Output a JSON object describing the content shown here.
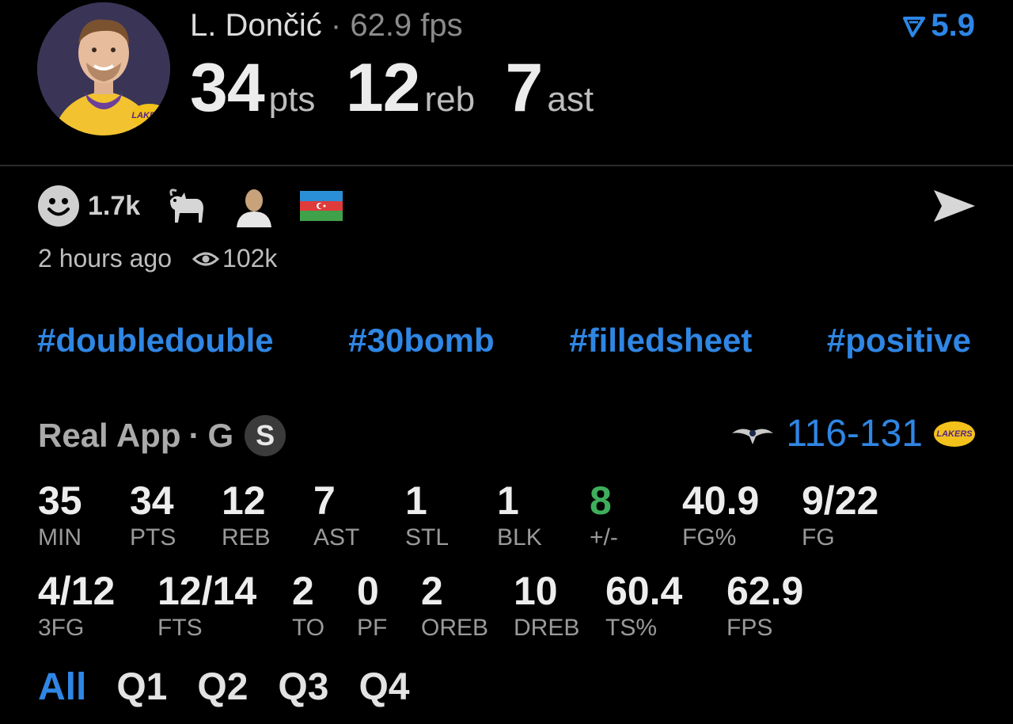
{
  "player": {
    "name": "L. Dončić",
    "separator": "·",
    "fps_text": "62.9 fps",
    "pts": "34",
    "pts_unit": "pts",
    "reb": "12",
    "reb_unit": "reb",
    "ast": "7",
    "ast_unit": "ast",
    "team_logo_text": "LAKERS"
  },
  "trend": {
    "value": "5.9",
    "icon": "trend-arrow-icon",
    "color": "#2d86e6"
  },
  "reactions": {
    "count": "1.7k",
    "icons": [
      "smiley-icon",
      "goat-icon",
      "person-emoji-icon",
      "azerbaijan-flag-icon"
    ]
  },
  "meta": {
    "time": "2 hours ago",
    "views": "102k"
  },
  "tags": [
    "#doubledouble",
    "#30bomb",
    "#filledsheet",
    "#positive"
  ],
  "game": {
    "source": "Real App",
    "separator": "·",
    "position": "G",
    "badge": "S",
    "score": "116-131",
    "home_logo_text": "LAKERS"
  },
  "stats_row1": [
    {
      "value": "35",
      "label": "MIN"
    },
    {
      "value": "34",
      "label": "PTS"
    },
    {
      "value": "12",
      "label": "REB"
    },
    {
      "value": "7",
      "label": "AST"
    },
    {
      "value": "1",
      "label": "STL"
    },
    {
      "value": "1",
      "label": "BLK"
    },
    {
      "value": "8",
      "label": "+/-"
    },
    {
      "value": "40.9",
      "label": "FG%"
    },
    {
      "value": "9/22",
      "label": "FG"
    }
  ],
  "stats_row2": [
    {
      "value": "4/12",
      "label": "3FG"
    },
    {
      "value": "12/14",
      "label": "FTS"
    },
    {
      "value": "2",
      "label": "TO"
    },
    {
      "value": "0",
      "label": "PF"
    },
    {
      "value": "2",
      "label": "OREB"
    },
    {
      "value": "10",
      "label": "DREB"
    },
    {
      "value": "60.4",
      "label": "TS%"
    },
    {
      "value": "62.9",
      "label": "FPS"
    }
  ],
  "quarters": [
    "All",
    "Q1",
    "Q2",
    "Q3",
    "Q4"
  ],
  "colors": {
    "accent": "#2f86e4",
    "positive": "#3fae5c",
    "background": "#000000"
  }
}
